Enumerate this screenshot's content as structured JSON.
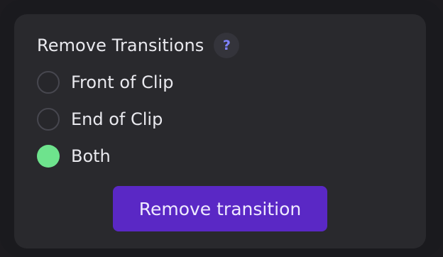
{
  "panel": {
    "title": "Remove Transitions",
    "help_label": "?"
  },
  "options": [
    {
      "label": "Front of Clip",
      "selected": false
    },
    {
      "label": "End of Clip",
      "selected": false
    },
    {
      "label": "Both",
      "selected": true
    }
  ],
  "action": {
    "button_label": "Remove transition"
  },
  "colors": {
    "selected_radio": "#6ee38d",
    "button_bg": "#5a28c5",
    "help_icon": "#7f83ff"
  }
}
